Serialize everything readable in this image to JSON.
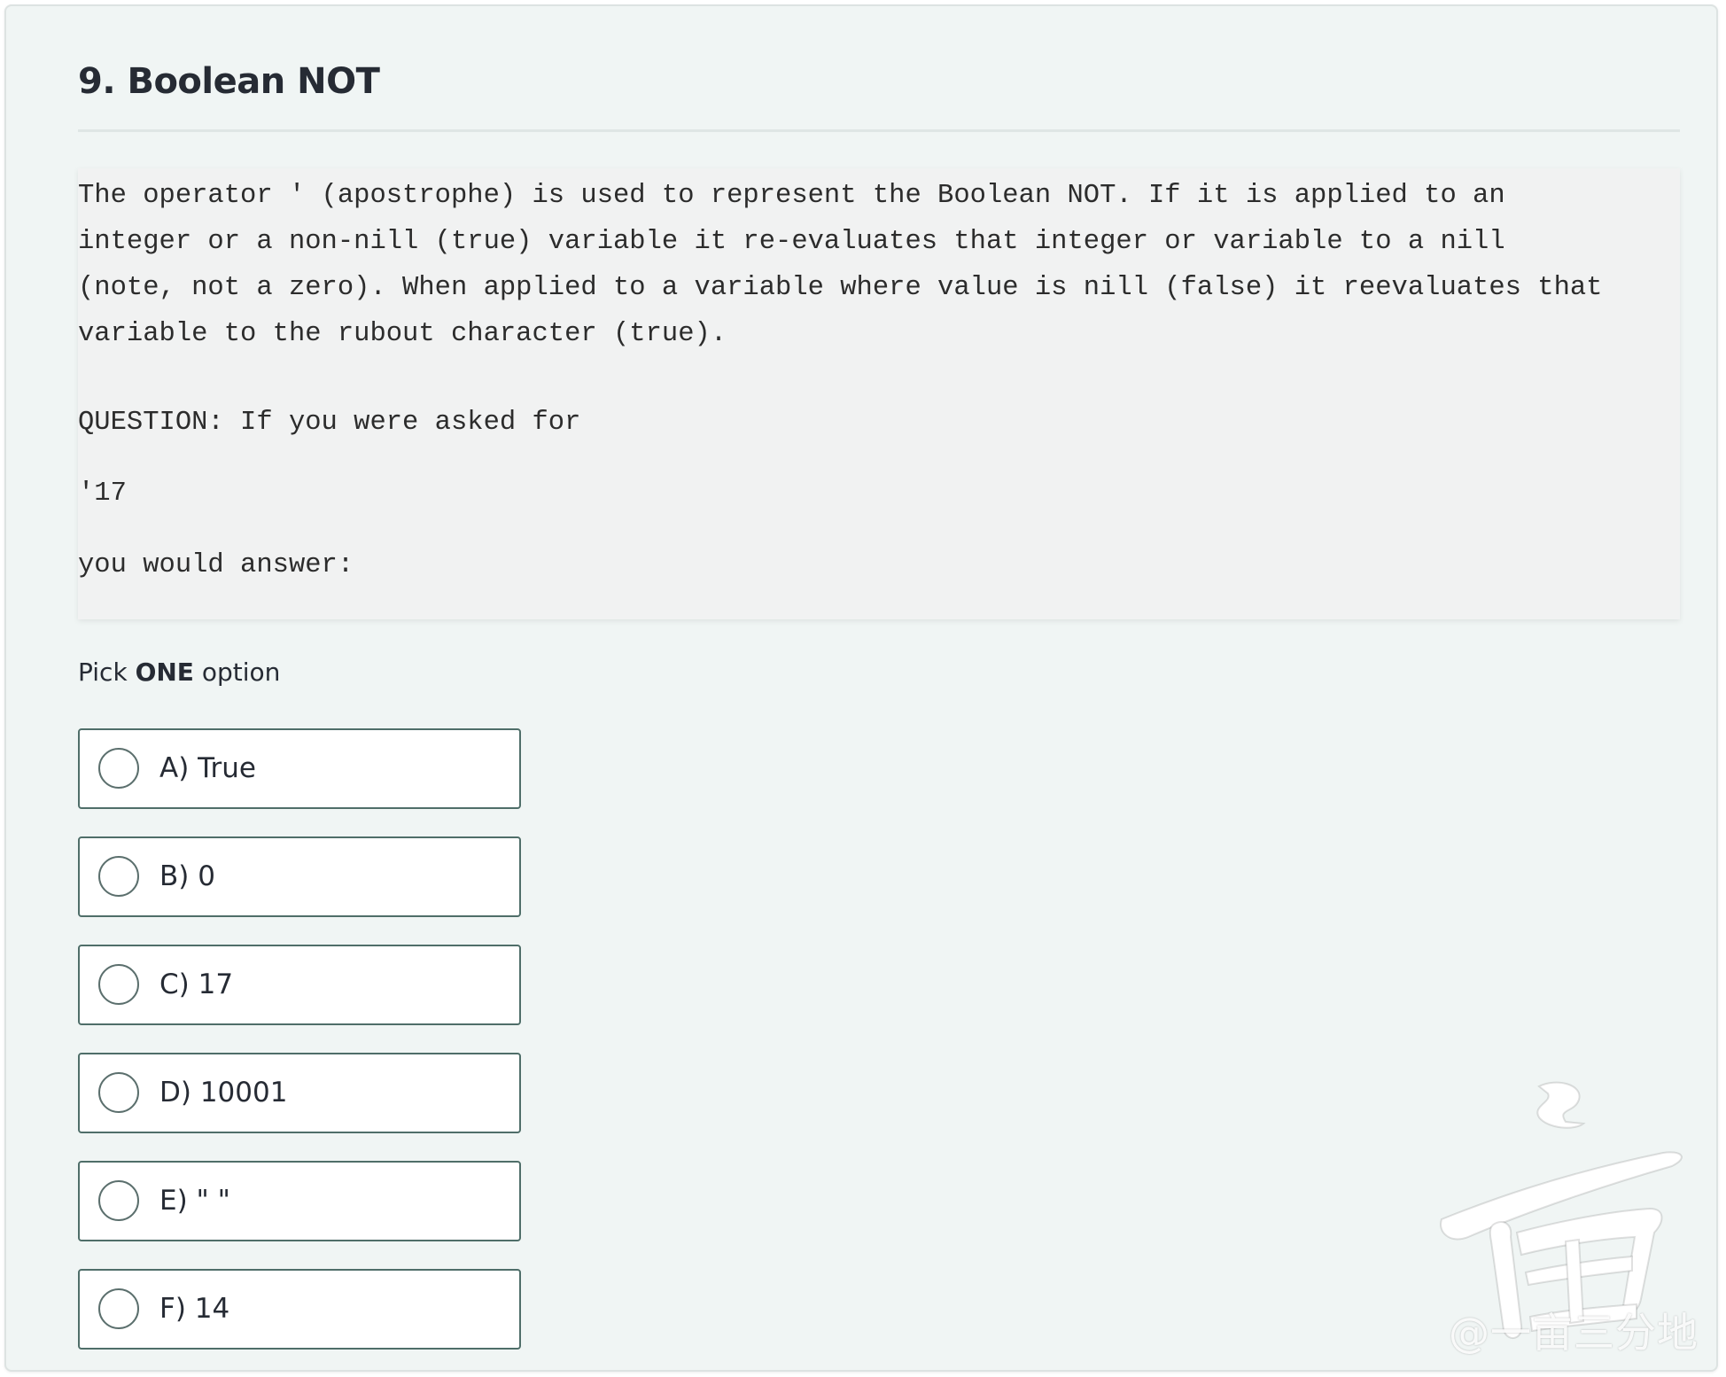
{
  "question": {
    "title": "9. Boolean NOT",
    "statement": [
      "The operator ' (apostrophe) is used to represent the Boolean NOT. If it is applied to an",
      "integer or a non-nill (true) variable it re-evaluates that integer or variable to a nill",
      "(note, not a zero). When applied to a variable where value is nill (false) it reevaluates that",
      "variable to the rubout character (true)."
    ],
    "prompt": "QUESTION: If you were asked for",
    "expression": "'17",
    "answer_lead": "you would answer:"
  },
  "instructions": {
    "prefix": "Pick ",
    "emphasis": "ONE",
    "suffix": " option"
  },
  "options": [
    {
      "label": "A) True",
      "selected": false
    },
    {
      "label": "B) 0",
      "selected": false
    },
    {
      "label": "C) 17",
      "selected": false
    },
    {
      "label": "D) 10001",
      "selected": false
    },
    {
      "label": "E) \" \"",
      "selected": false
    },
    {
      "label": "F) 14",
      "selected": false
    }
  ],
  "watermark": {
    "logo_char": "亩",
    "text": "@一亩三分地"
  },
  "colors": {
    "card_bg": "#f0f5f4",
    "problem_bg": "#f1f2f2",
    "option_border": "#4f6e69",
    "title_text": "#262b34"
  }
}
